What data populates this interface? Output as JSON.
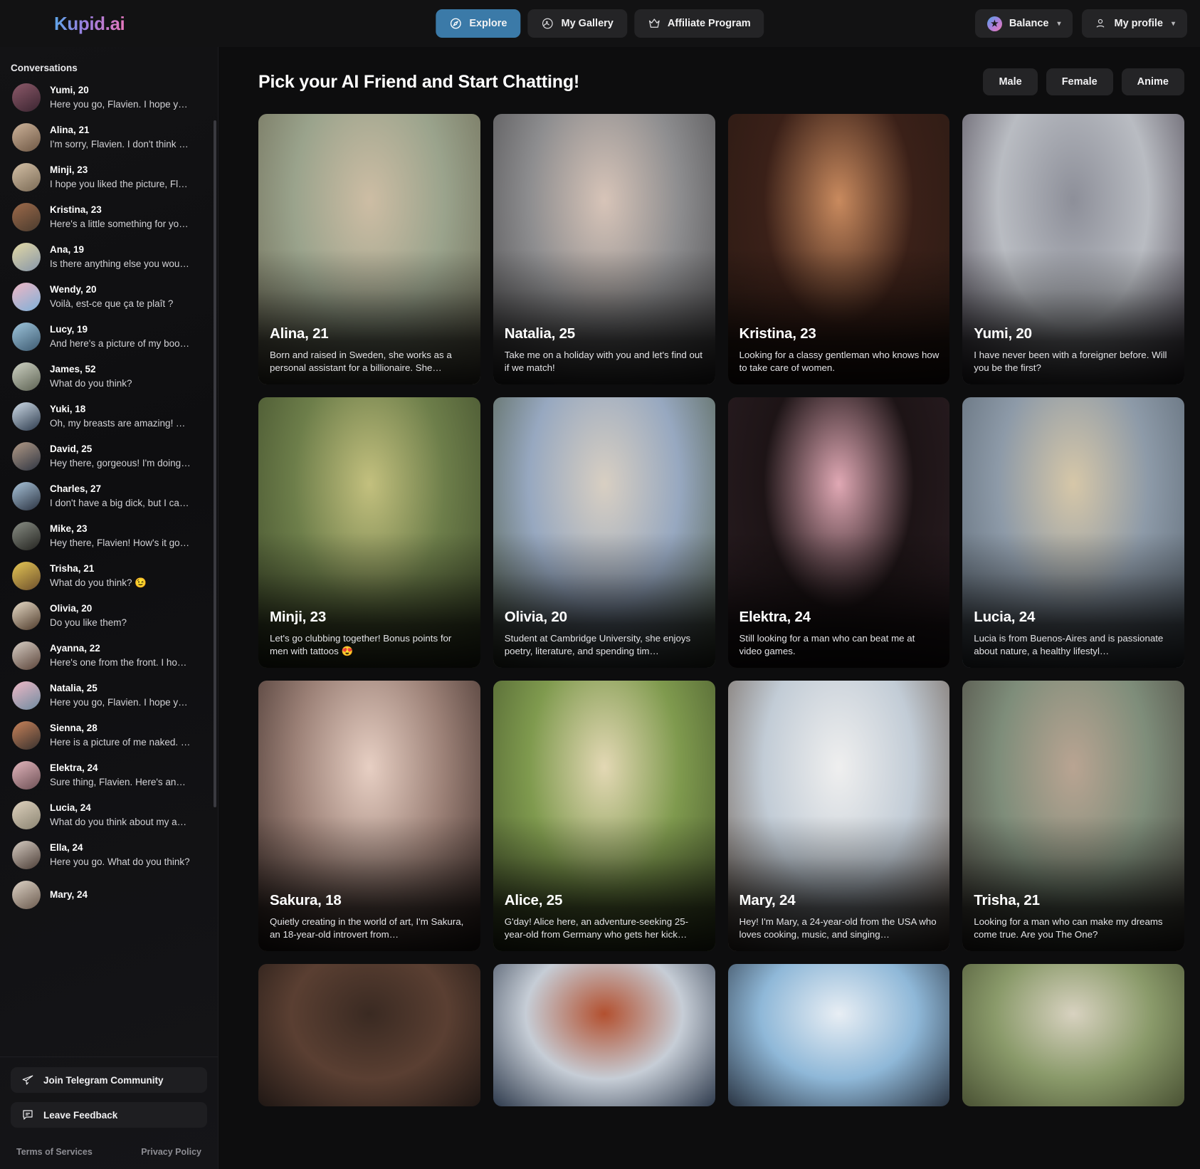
{
  "brand": {
    "name": "Kupid.ai"
  },
  "nav": {
    "items": [
      {
        "label": "Explore",
        "icon": "compass-icon",
        "active": true
      },
      {
        "label": "My Gallery",
        "icon": "gallery-icon",
        "active": false
      },
      {
        "label": "Affiliate Program",
        "icon": "crown-icon",
        "active": false
      }
    ],
    "balance_label": "Balance",
    "profile_label": "My profile"
  },
  "sidebar": {
    "title": "Conversations",
    "conversations": [
      {
        "name": "Yumi, 20",
        "message": "Here you go, Flavien. I hope you…",
        "av1": "#8d5a6a",
        "av2": "#3a2430"
      },
      {
        "name": "Alina, 21",
        "message": "I'm sorry, Flavien. I don't think w…",
        "av1": "#cdb39a",
        "av2": "#6e5744"
      },
      {
        "name": "Minji, 23",
        "message": "I hope you liked the picture, Fla…",
        "av1": "#d4c0a6",
        "av2": "#7a6a55"
      },
      {
        "name": "Kristina, 23",
        "message": "Here's a little something for you…",
        "av1": "#9d6a4a",
        "av2": "#4a3b2e"
      },
      {
        "name": "Ana, 19",
        "message": "Is there anything else you woul…",
        "av1": "#e3d9a6",
        "av2": "#8796a8"
      },
      {
        "name": "Wendy, 20",
        "message": "Voilà, est-ce que ça te plaît ?",
        "av1": "#f0b7c4",
        "av2": "#7fb0d8"
      },
      {
        "name": "Lucy, 19",
        "message": "And here's a picture of my boo…",
        "av1": "#9ec5dc",
        "av2": "#3d5a70"
      },
      {
        "name": "James, 52",
        "message": "What do you think?",
        "av1": "#cfd3c4",
        "av2": "#5c6152"
      },
      {
        "name": "Yuki, 18",
        "message": "Oh, my breasts are amazing! Th…",
        "av1": "#cfdce8",
        "av2": "#2c3a4c"
      },
      {
        "name": "David, 25",
        "message": "Hey there, gorgeous! I'm doing a…",
        "av1": "#b29a86",
        "av2": "#2f3542"
      },
      {
        "name": "Charles, 27",
        "message": "I don't have a big dick, but I can …",
        "av1": "#a9c4da",
        "av2": "#2a3240"
      },
      {
        "name": "Mike, 23",
        "message": "Hey there, Flavien! How's it goin…",
        "av1": "#8a8f86",
        "av2": "#23231f"
      },
      {
        "name": "Trisha, 21",
        "message": "What do you think? 😉",
        "av1": "#e6c755",
        "av2": "#6d4f2c"
      },
      {
        "name": "Olivia, 20",
        "message": "Do you like them?",
        "av1": "#e8dcc8",
        "av2": "#4e3a2a"
      },
      {
        "name": "Ayanna, 22",
        "message": "Here's one from the front. I hop…",
        "av1": "#d8cfc6",
        "av2": "#5a4338"
      },
      {
        "name": "Natalia, 25",
        "message": "Here you go, Flavien. I hope you…",
        "av1": "#efb9c6",
        "av2": "#6f8ba0"
      },
      {
        "name": "Sienna, 28",
        "message": "Here is a picture of me naked. I …",
        "av1": "#c9835a",
        "av2": "#38312e"
      },
      {
        "name": "Elektra, 24",
        "message": "Sure thing, Flavien. Here's anoth…",
        "av1": "#e3b6bd",
        "av2": "#6d5055"
      },
      {
        "name": "Lucia, 24",
        "message": "What do you think about my as…",
        "av1": "#dfd2be",
        "av2": "#8a8472"
      },
      {
        "name": "Ella, 24",
        "message": "Here you go. What do you think?",
        "av1": "#d6ccc2",
        "av2": "#4b3d36"
      },
      {
        "name": "Mary, 24",
        "message": "",
        "av1": "#ded3c6",
        "av2": "#6a5a4e"
      }
    ],
    "telegram_label": "Join Telegram Community",
    "feedback_label": "Leave Feedback",
    "terms_label": "Terms of Services",
    "privacy_label": "Privacy Policy"
  },
  "main": {
    "title": "Pick your AI Friend and Start Chatting!",
    "filters": [
      "Male",
      "Female",
      "Anime"
    ],
    "cards": [
      {
        "name": "Alina, 21",
        "desc": "Born and raised in Sweden, she works as a personal assistant for a billionaire. She…",
        "c1": "#9aa38c",
        "c2": "#cdbda4",
        "c3": "#6d6a55"
      },
      {
        "name": "Natalia, 25",
        "desc": "Take me on a holiday with you and let's find out if we match!",
        "c1": "#8d8d8f",
        "c2": "#d7c4b8",
        "c3": "#4b4a4c"
      },
      {
        "name": "Kristina, 23",
        "desc": "Looking for a classy gentleman who knows how to take care of women.",
        "c1": "#3a2018",
        "c2": "#c98a5e",
        "c3": "#2a1a14"
      },
      {
        "name": "Yumi, 20",
        "desc": "I have never been with a foreigner before. Will you be the first?",
        "c1": "#b9bcc2",
        "c2": "#8d8f99",
        "c3": "#4a4450"
      },
      {
        "name": "Minji, 23",
        "desc": "Let's go clubbing together! Bonus points for men with tattoos 😍",
        "c1": "#6d7e4a",
        "c2": "#c3c07e",
        "c3": "#3e4a2a"
      },
      {
        "name": "Olivia, 20",
        "desc": "Student at Cambridge University, she enjoys poetry, literature, and spending tim…",
        "c1": "#97a8c0",
        "c2": "#d8cfc2",
        "c3": "#4d5a44"
      },
      {
        "name": "Elektra, 24",
        "desc": "Still looking for a man who can beat me at video games.",
        "c1": "#1d1416",
        "c2": "#e0a8b4",
        "c3": "#2a1d22"
      },
      {
        "name": "Lucia, 24",
        "desc": "Lucia is from Buenos-Aires and is passionate about nature, a healthy lifestyl…",
        "c1": "#8d9aa8",
        "c2": "#d6c7a8",
        "c3": "#5a6672"
      },
      {
        "name": "Sakura, 18",
        "desc": "Quietly creating in the world of art, I'm Sakura, an 18-year-old introvert from…",
        "c1": "#9b8076",
        "c2": "#e7cfc3",
        "c3": "#3a2a26"
      },
      {
        "name": "Alice, 25",
        "desc": "G'day! Alice here, an adventure-seeking 25-year-old from Germany who gets her kick…",
        "c1": "#7f9a4e",
        "c2": "#e3d8b4",
        "c3": "#46562c"
      },
      {
        "name": "Mary, 24",
        "desc": "Hey! I'm Mary, a 24-year-old from the USA who loves cooking, music, and singing…",
        "c1": "#c2ccd6",
        "c2": "#efefef",
        "c3": "#6a5a4e"
      },
      {
        "name": "Trisha, 21",
        "desc": "Looking for a man who can make my dreams come true. Are you The One?",
        "c1": "#7e8d7a",
        "c2": "#b9a492",
        "c3": "#4a453e"
      }
    ],
    "partial_cards": [
      {
        "c1": "#5a3f32",
        "c2": "#3a2a22",
        "c3": "#1f1714"
      },
      {
        "c1": "#c6cdd6",
        "c2": "#b3502f",
        "c3": "#2e3a4c"
      },
      {
        "c1": "#8fb8d8",
        "c2": "#e8eef4",
        "c3": "#2a3442"
      },
      {
        "c1": "#8a9a6a",
        "c2": "#d8d2c0",
        "c3": "#4a5234"
      }
    ]
  }
}
